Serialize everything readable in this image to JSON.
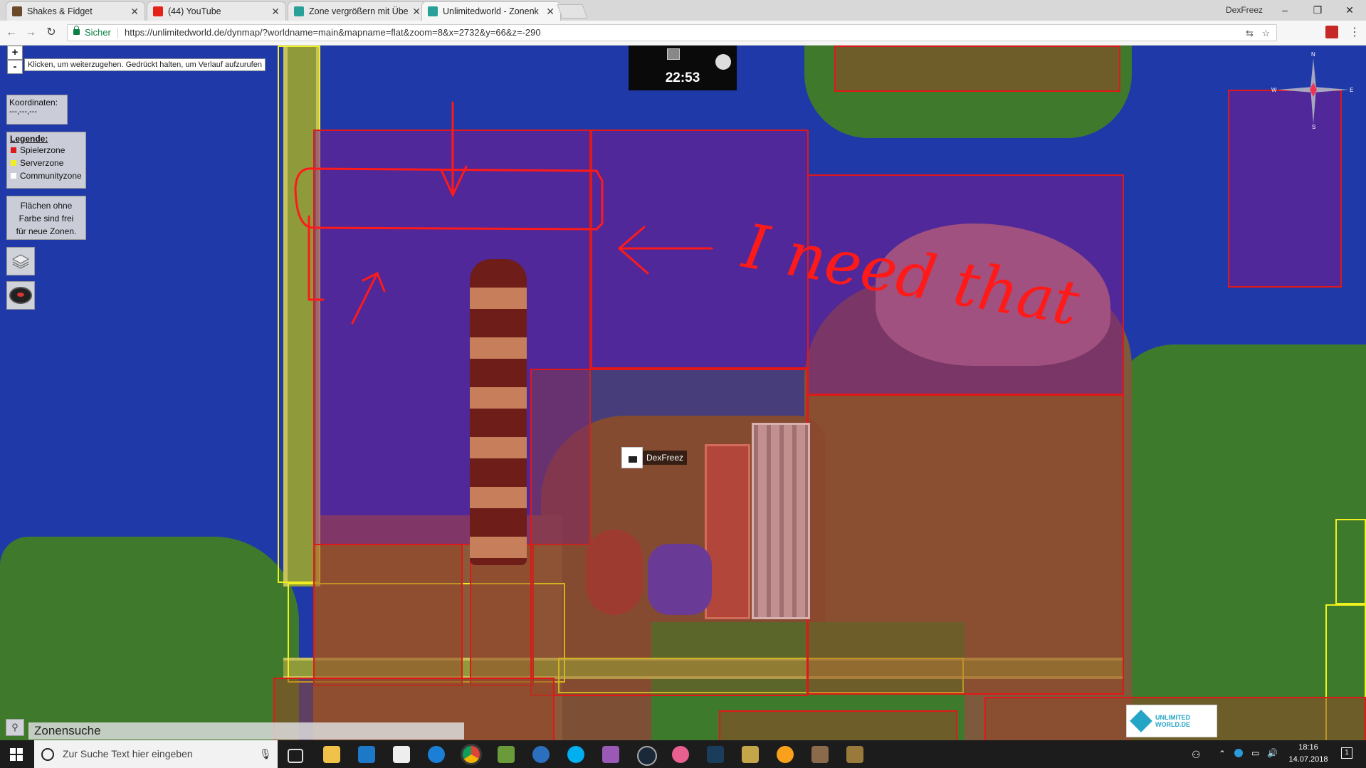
{
  "browser": {
    "tabs": [
      {
        "title": "Shakes & Fidget",
        "active": false,
        "favicon_color": "#6b4a2a"
      },
      {
        "title": "(44) YouTube",
        "active": false,
        "favicon_color": "#e62117"
      },
      {
        "title": "Zone vergrößern mit Übe",
        "active": false,
        "favicon_color": "#2aa198"
      },
      {
        "title": "Unlimitedworld - Zonenk",
        "active": true,
        "favicon_color": "#2aa198"
      }
    ],
    "window_user": "DexFreez",
    "secure_label": "Sicher",
    "url": "https://unlimitedworld.de/dynmap/?worldname=main&mapname=flat&zoom=8&x=2732&y=66&z=-290"
  },
  "map": {
    "zoom_in": "+",
    "zoom_out": "-",
    "zoom_tooltip": "Klicken, um weiterzugehen. Gedrückt halten, um Verlauf aufzurufen",
    "coordinates_label": "Koordinaten:",
    "coordinates_value": "---,---,---",
    "legend": {
      "title": "Legende:",
      "items": [
        {
          "label": "Spielerzone",
          "color": "#e01818"
        },
        {
          "label": "Serverzone",
          "color": "#f0f020"
        },
        {
          "label": "Communityzone",
          "color": "#ffffff"
        }
      ]
    },
    "free_area_note": "Flächen ohne Farbe sind frei für neue Zonen.",
    "clock": "22:53",
    "compass": {
      "n": "N",
      "e": "E",
      "s": "S",
      "w": "W"
    },
    "player_name": "DexFreez",
    "zone_search": "Zonensuche",
    "logo_text": "UNLIMITED WORLD.DE",
    "annotation_text": "I need that"
  },
  "taskbar": {
    "search_placeholder": "Zur Suche Text hier eingeben",
    "time": "18:16",
    "date": "14.07.2018",
    "notification_count": "1"
  }
}
